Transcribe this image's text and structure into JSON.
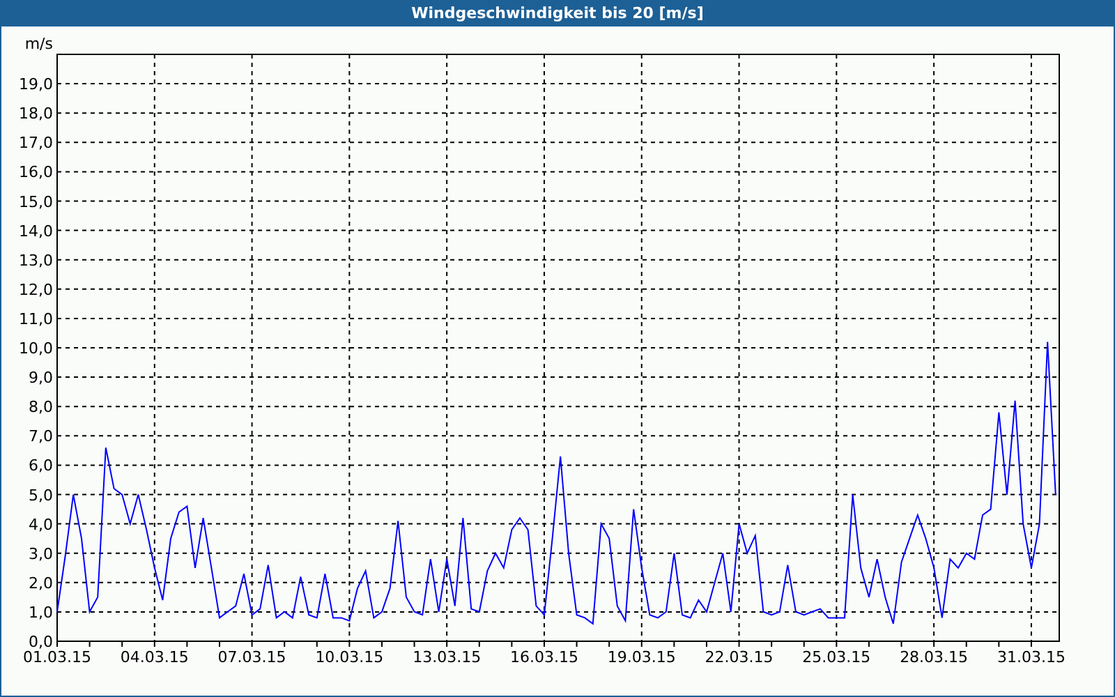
{
  "window": {
    "title": "Windgeschwindigkeit bis 20 [m/s]"
  },
  "chart": {
    "chart_data": {
      "type": "line",
      "grid": true,
      "ylabel": "m/s",
      "ylim": [
        0,
        20
      ],
      "yticks": [
        {
          "value": 0,
          "label": "0,0"
        },
        {
          "value": 1,
          "label": "1,0"
        },
        {
          "value": 2,
          "label": "2,0"
        },
        {
          "value": 3,
          "label": "3,0"
        },
        {
          "value": 4,
          "label": "4,0"
        },
        {
          "value": 5,
          "label": "5,0"
        },
        {
          "value": 6,
          "label": "6,0"
        },
        {
          "value": 7,
          "label": "7,0"
        },
        {
          "value": 8,
          "label": "8,0"
        },
        {
          "value": 9,
          "label": "9,0"
        },
        {
          "value": 10,
          "label": "10,0"
        },
        {
          "value": 11,
          "label": "11,0"
        },
        {
          "value": 12,
          "label": "12,0"
        },
        {
          "value": 13,
          "label": "13,0"
        },
        {
          "value": 14,
          "label": "14,0"
        },
        {
          "value": 15,
          "label": "15,0"
        },
        {
          "value": 16,
          "label": "16,0"
        },
        {
          "value": 17,
          "label": "17,0"
        },
        {
          "value": 18,
          "label": "18,0"
        },
        {
          "value": 19,
          "label": "19,0"
        }
      ],
      "categories": [
        "01.03.15",
        null,
        null,
        null,
        null,
        null,
        null,
        null,
        null,
        null,
        null,
        null,
        "04.03.15",
        null,
        null,
        null,
        null,
        null,
        null,
        null,
        null,
        null,
        null,
        null,
        "07.03.15",
        null,
        null,
        null,
        null,
        null,
        null,
        null,
        null,
        null,
        null,
        null,
        "10.03.15",
        null,
        null,
        null,
        null,
        null,
        null,
        null,
        null,
        null,
        null,
        null,
        "13.03.15",
        null,
        null,
        null,
        null,
        null,
        null,
        null,
        null,
        null,
        null,
        null,
        "16.03.15",
        null,
        null,
        null,
        null,
        null,
        null,
        null,
        null,
        null,
        null,
        null,
        "19.03.15",
        null,
        null,
        null,
        null,
        null,
        null,
        null,
        null,
        null,
        null,
        null,
        "22.03.15",
        null,
        null,
        null,
        null,
        null,
        null,
        null,
        null,
        null,
        null,
        null,
        "25.03.15",
        null,
        null,
        null,
        null,
        null,
        null,
        null,
        null,
        null,
        null,
        null,
        "28.03.15",
        null,
        null,
        null,
        null,
        null,
        null,
        null,
        null,
        null,
        null,
        null,
        "31.03.15",
        null,
        null,
        null
      ],
      "series": [
        {
          "color": "#0000ff",
          "values": [
            1.0,
            2.9,
            5.0,
            3.5,
            1.0,
            1.5,
            6.6,
            5.2,
            5.0,
            4.0,
            5.0,
            3.8,
            2.5,
            1.4,
            3.5,
            4.4,
            4.6,
            2.5,
            4.2,
            2.5,
            0.8,
            1.0,
            1.2,
            2.3,
            0.9,
            1.1,
            2.6,
            0.8,
            1.0,
            0.8,
            2.2,
            0.9,
            0.8,
            2.3,
            0.8,
            0.8,
            0.7,
            1.8,
            2.4,
            0.8,
            1.0,
            1.8,
            4.1,
            1.5,
            1.0,
            0.9,
            2.8,
            1.0,
            2.8,
            1.2,
            4.2,
            1.1,
            1.0,
            2.4,
            3.0,
            2.5,
            3.8,
            4.2,
            3.8,
            1.2,
            0.9,
            3.5,
            6.3,
            3.0,
            0.9,
            0.8,
            0.6,
            4.0,
            3.5,
            1.2,
            0.7,
            4.5,
            2.5,
            0.9,
            0.8,
            1.0,
            3.0,
            0.9,
            0.8,
            1.4,
            1.0,
            2.0,
            3.0,
            1.0,
            4.0,
            3.0,
            3.6,
            1.0,
            0.9,
            1.0,
            2.6,
            1.0,
            0.9,
            1.0,
            1.1,
            0.8,
            0.8,
            0.8,
            5.0,
            2.5,
            1.5,
            2.8,
            1.5,
            0.6,
            2.7,
            3.5,
            4.3,
            3.5,
            2.5,
            0.8,
            2.8,
            2.5,
            3.0,
            2.8,
            4.3,
            4.5,
            7.8,
            5.0,
            8.2,
            4.0,
            2.5,
            4.0,
            10.2,
            5.0
          ]
        }
      ]
    }
  }
}
